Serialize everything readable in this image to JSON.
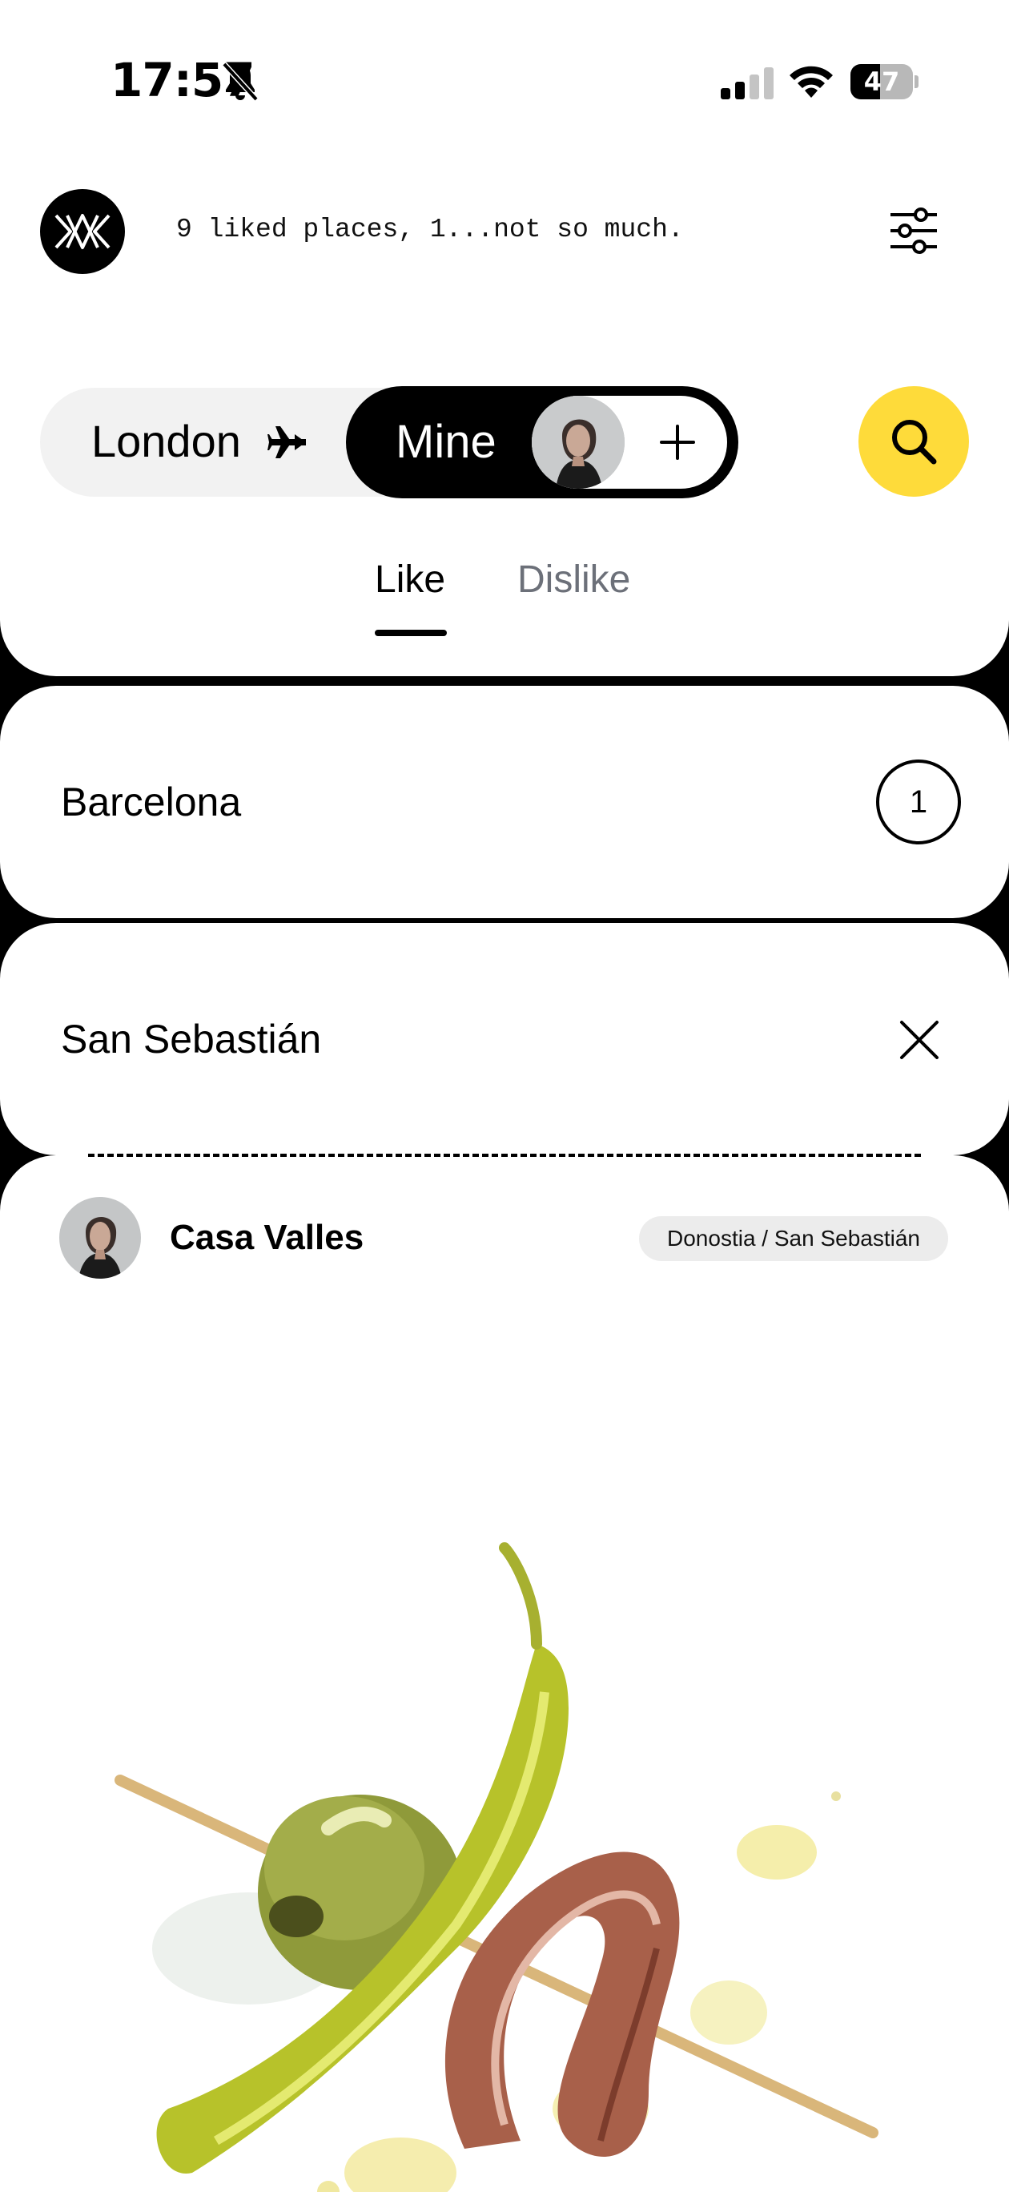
{
  "status_bar": {
    "time": "17:57",
    "battery_level": 47,
    "battery_text": "47"
  },
  "header": {
    "tagline": "9 liked places, 1...not so much."
  },
  "selector": {
    "city_label": "London",
    "mine_label": "Mine"
  },
  "tabs": [
    {
      "label": "Like",
      "active": true
    },
    {
      "label": "Dislike",
      "active": false
    }
  ],
  "cities": [
    {
      "name": "Barcelona",
      "count": "1"
    },
    {
      "name": "San Sebastián"
    }
  ],
  "place": {
    "name": "Casa Valles",
    "location": "Donostia / San Sebastián"
  },
  "colors": {
    "accent_yellow": "#fedb3a",
    "inactive_tab": "#6c7079"
  },
  "icons": {
    "logo": "mw-monogram-logo",
    "filter": "sliders-icon",
    "plane": "plane-icon",
    "add": "plus-icon",
    "search": "search-icon",
    "close": "close-icon"
  }
}
